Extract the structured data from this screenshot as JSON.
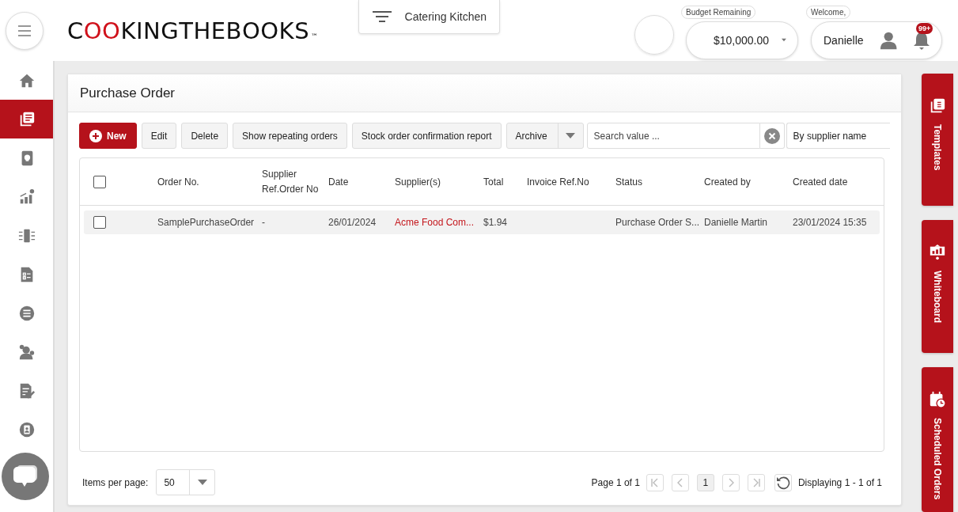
{
  "header": {
    "logo": "COOKINGTHEBOOKS",
    "trademark": "™",
    "kitchen": "Catering Kitchen",
    "budget": {
      "label": "Budget Remaining",
      "value": "$10,000.00"
    },
    "user": {
      "label": "Welcome,",
      "name": "Danielle",
      "notifications": "99+"
    }
  },
  "sidebar": {
    "items": [
      {
        "selected": false
      },
      {
        "selected": true
      },
      {
        "selected": false
      },
      {
        "selected": false
      },
      {
        "selected": false
      },
      {
        "selected": false
      },
      {
        "selected": false
      },
      {
        "selected": false
      },
      {
        "selected": false
      },
      {
        "selected": false
      }
    ]
  },
  "page": {
    "title": "Purchase Order"
  },
  "toolbar": {
    "buttons": [
      {
        "label": "New",
        "kind": "primary"
      },
      {
        "label": "Edit",
        "kind": "plain"
      },
      {
        "label": "Delete",
        "kind": "plain"
      },
      {
        "label": "Show repeating orders",
        "kind": "plain"
      },
      {
        "label": "Stock order confirmation report",
        "kind": "plain"
      }
    ],
    "archive": "Archive",
    "search": {
      "placeholder": "Search value ..."
    },
    "filter": "By supplier name"
  },
  "table": {
    "select_all_checked": false,
    "columns": [
      "Order No.",
      "Supplier Ref.Order No",
      "Date",
      "Supplier(s)",
      "Total",
      "Invoice Ref.No",
      "Status",
      "Created by",
      "Created date"
    ],
    "rows": [
      {
        "checked": false,
        "cells": [
          "SamplePurchaseOrder",
          "-",
          "26/01/2024",
          "Acme Food Com...",
          "$1.94",
          "",
          "Purchase Order S...",
          "Danielle Martin",
          "23/01/2024 15:35"
        ]
      }
    ]
  },
  "pager": {
    "label": "Items per page:",
    "per_page": "50",
    "page_info": "Page 1 of 1",
    "current": "1",
    "display": "Displaying 1 - 1 of 1"
  },
  "side_tabs": [
    {
      "label": "Templates"
    },
    {
      "label": "Whiteboard"
    },
    {
      "label": "Scheduled Orders"
    }
  ]
}
